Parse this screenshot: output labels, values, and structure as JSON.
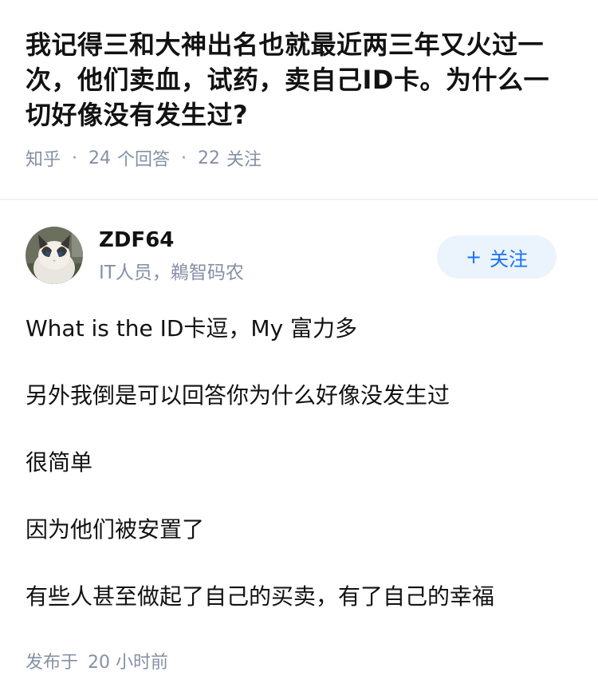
{
  "question": {
    "title": "我记得三和大神出名也就最近两三年又火过一次，他们卖血，试药，卖自己ID卡。为什么一切好像没有发生过?",
    "source": "知乎",
    "answers_count": "24",
    "answers_label": "个回答",
    "followers_count": "22",
    "followers_label": "关注"
  },
  "answer": {
    "author": {
      "name": "ZDF64",
      "bio": "IT人员，鵜智码农",
      "avatar_icon": "cat-avatar"
    },
    "follow_button": {
      "plus": "+",
      "label": "关注"
    },
    "paragraphs": [
      "What is the ID卡逗，My 富力多",
      "另外我倒是可以回答你为什么好像没发生过",
      "很简单",
      "因为他们被安置了",
      "有些人甚至做起了自己的买卖，有了自己的幸福"
    ],
    "published_label": "发布于",
    "published_time": "20 小时前"
  },
  "colors": {
    "text": "#121212",
    "meta": "#8590a6",
    "accent": "#1772f6",
    "button_bg": "#ebf3fd"
  }
}
